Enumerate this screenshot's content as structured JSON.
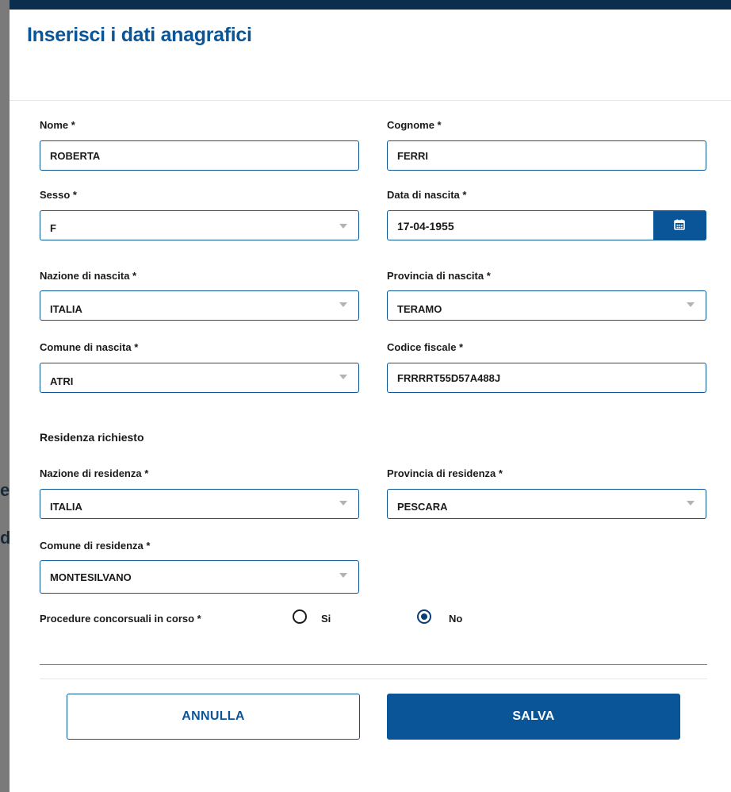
{
  "dialog": {
    "title": "Inserisci i dati anagrafici"
  },
  "fields": {
    "nome": {
      "label": "Nome *",
      "value": "ROBERTA"
    },
    "cognome": {
      "label": "Cognome *",
      "value": "FERRI"
    },
    "sesso": {
      "label": "Sesso *",
      "value": "F"
    },
    "data_nascita": {
      "label": "Data di nascita *",
      "value": "17-04-1955",
      "button_icon": "calendar-icon"
    },
    "nazione_nascita": {
      "label": "Nazione di nascita *",
      "value": "ITALIA"
    },
    "provincia_nascita": {
      "label": "Provincia di nascita *",
      "value": "TERAMO"
    },
    "comune_nascita": {
      "label": "Comune di nascita *",
      "value": "ATRI"
    },
    "codice_fiscale": {
      "label": "Codice fiscale *",
      "value": "FRRRRT55D57A488J"
    }
  },
  "residenza": {
    "section_title": "Residenza richiesto",
    "nazione": {
      "label": "Nazione di residenza *",
      "value": "ITALIA"
    },
    "provincia": {
      "label": "Provincia di residenza *",
      "value": "PESCARA"
    },
    "comune": {
      "label": "Comune di residenza *",
      "value": "MONTESILVANO"
    }
  },
  "procedure": {
    "label": "Procedure concorsuali in corso *",
    "options": [
      {
        "label": "Si",
        "selected": false
      },
      {
        "label": "No",
        "selected": true
      }
    ]
  },
  "buttons": {
    "cancel": "ANNULLA",
    "save": "SALVA"
  },
  "colors": {
    "primary": "#0a5598",
    "overlay": "#6f6f6f",
    "divider": "#6b8f6b"
  }
}
